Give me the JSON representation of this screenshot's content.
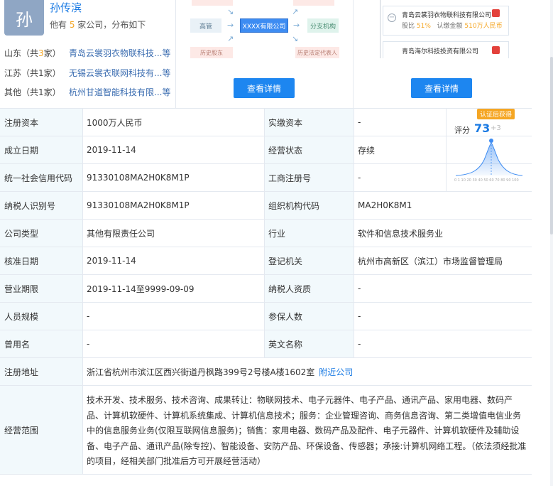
{
  "person": {
    "avatar_char": "孙",
    "name": "孙传滨",
    "sub_prefix": "他有 ",
    "company_count": "5",
    "sub_suffix": " 家公司，分布如下"
  },
  "provinces": [
    {
      "province": "山东（共",
      "count": "3",
      "suffix": "家）",
      "company": "青岛云裳羽衣物联科技...等"
    },
    {
      "province": "江苏（共1家）",
      "count": "",
      "suffix": "",
      "company": "无锡云裳衣联网科技有...等"
    },
    {
      "province": "其他（共1家）",
      "count": "",
      "suffix": "",
      "company": "杭州甘道智能科技有限...等"
    }
  ],
  "structure_chart": {
    "left_box": "高管",
    "center_box": "XXXX有限公司",
    "right_box": "分支机构",
    "bottom_left": "历史股东",
    "bottom_right": "历史法定代表人"
  },
  "detail_button_left": "查看详情",
  "detail_button_right": "查看详情",
  "related": [
    {
      "name": "青岛云裳羽衣物联科技有限公司",
      "ratio_label": "股比",
      "ratio": "51%",
      "amount_label": "认缴金额",
      "amount": "510万人民币"
    },
    {
      "name": "青岛海尔科技投资有限公司"
    }
  ],
  "score": {
    "tag": "认证后获得",
    "label": "评分",
    "value": "73",
    "plus": "+3",
    "axis_ticks": "0 1 10 20 30 40 50 60 70 80 90 100"
  },
  "info": {
    "reg_capital_label": "注册资本",
    "reg_capital": "1000万人民币",
    "paid_capital_label": "实缴资本",
    "paid_capital": "-",
    "found_date_label": "成立日期",
    "found_date": "2019-11-14",
    "status_label": "经营状态",
    "status": "存续",
    "credit_code_label": "统一社会信用代码",
    "credit_code": "91330108MA2H0K8M1P",
    "biz_reg_label": "工商注册号",
    "biz_reg": "-",
    "taxpayer_id_label": "纳税人识别号",
    "taxpayer_id": "91330108MA2H0K8M1P",
    "org_code_label": "组织机构代码",
    "org_code": "MA2H0K8M1",
    "company_type_label": "公司类型",
    "company_type": "其他有限责任公司",
    "industry_label": "行业",
    "industry": "软件和信息技术服务业",
    "approve_date_label": "核准日期",
    "approve_date": "2019-11-14",
    "reg_authority_label": "登记机关",
    "reg_authority": "杭州市高新区（滨江）市场监督管理局",
    "biz_term_label": "营业期限",
    "biz_term": "2019-11-14至9999-09-09",
    "tax_quality_label": "纳税人资质",
    "tax_quality": "-",
    "staff_size_label": "人员规模",
    "staff_size": "-",
    "insured_label": "参保人数",
    "insured": "-",
    "former_name_label": "曾用名",
    "former_name": "-",
    "english_name_label": "英文名称",
    "english_name": "-",
    "address_label": "注册地址",
    "address": "浙江省杭州市滨江区西兴街道丹枫路399号2号楼A楼1602室",
    "nearby_link": "附近公司",
    "scope_label": "经营范围",
    "scope": "技术开发、技术服务、技术咨询、成果转让：物联网技术、电子元器件、电子产品、通讯产品、家用电器、数码产品、计算机软硬件、计算机系统集成、计算机信息技术；服务：企业管理咨询、商务信息咨询、第二类增值电信业务中的信息服务业务(仅限互联网信息服务)；销售：家用电器、数码产品及配件、电子元器件、计算机软硬件及辅助设备、电子产品、通讯产品(除专控)、智能设备、安防产品、环保设备、传感器；承接:计算机网络工程。（依法须经批准的项目，经相关部门批准后方可开展经营活动）"
  }
}
